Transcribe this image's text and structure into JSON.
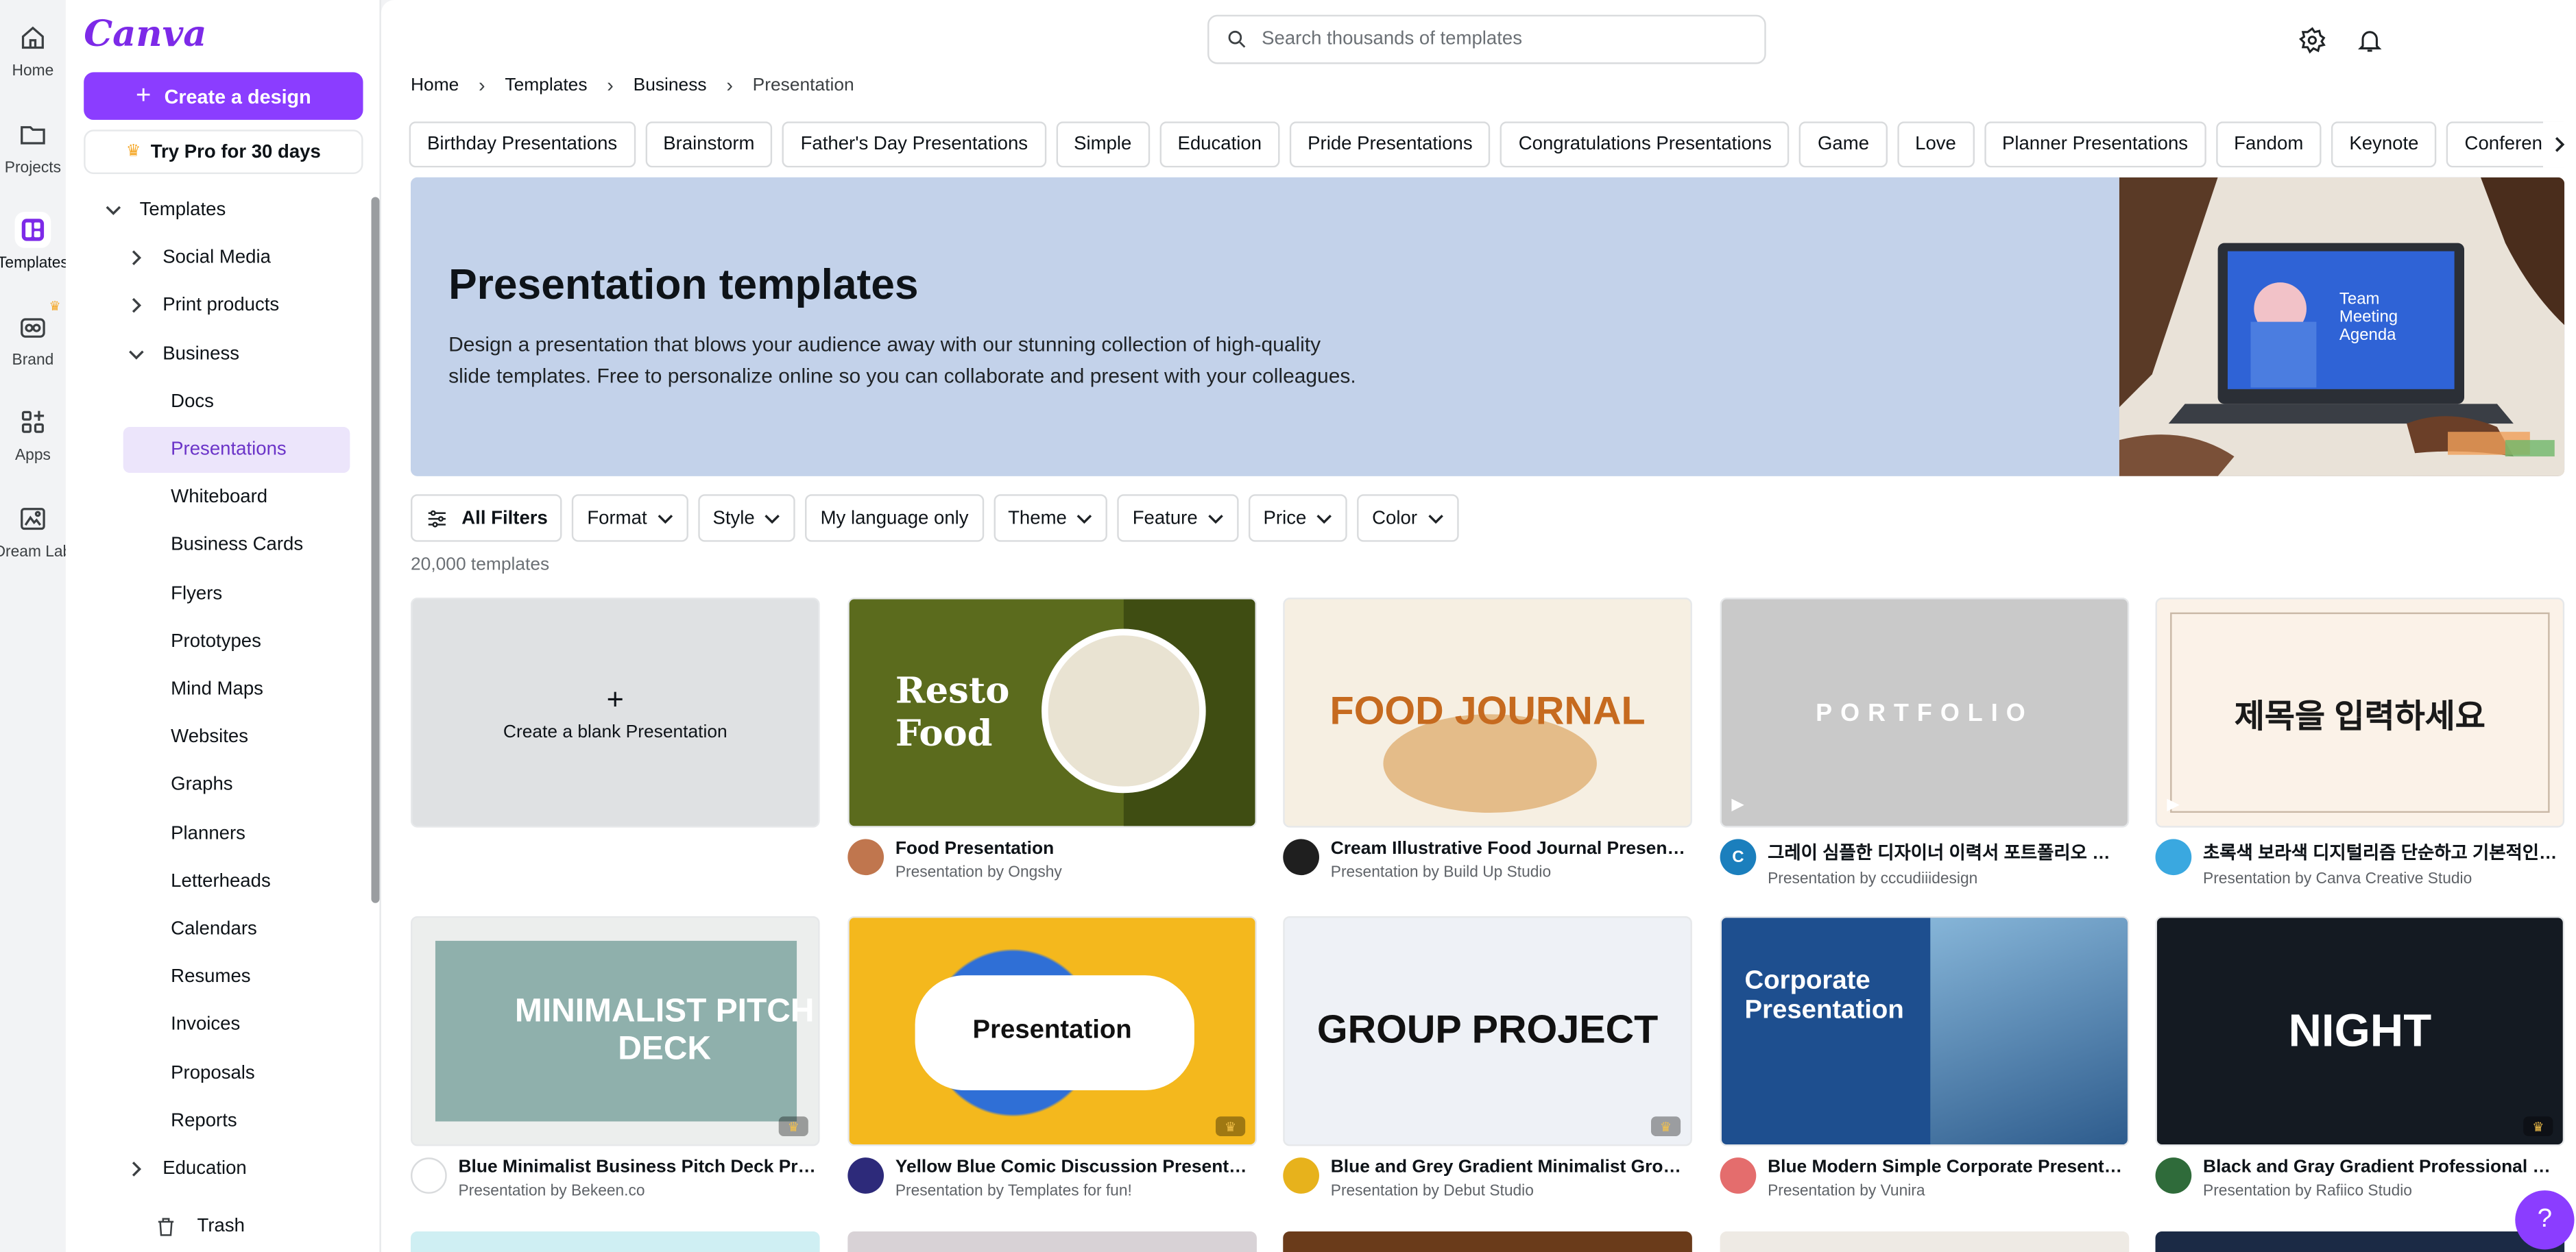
{
  "rail": [
    {
      "label": "Home",
      "icon": "home-icon"
    },
    {
      "label": "Projects",
      "icon": "folder-icon"
    },
    {
      "label": "Templates",
      "icon": "templates-icon"
    },
    {
      "label": "Brand",
      "icon": "brand-icon"
    },
    {
      "label": "Apps",
      "icon": "apps-icon"
    },
    {
      "label": "Dream Lab",
      "icon": "dream-lab-icon"
    }
  ],
  "panel": {
    "logo": "Canva",
    "create_label": "Create a design",
    "trypro_label": "Try Pro for 30 days",
    "tree": [
      {
        "label": "Templates",
        "level": 0,
        "chevron": "down"
      },
      {
        "label": "Social Media",
        "level": 1,
        "chevron": "right"
      },
      {
        "label": "Print products",
        "level": 1,
        "chevron": "right"
      },
      {
        "label": "Business",
        "level": 1,
        "chevron": "down"
      },
      {
        "label": "Docs",
        "level": 2
      },
      {
        "label": "Presentations",
        "level": 2,
        "active": true
      },
      {
        "label": "Whiteboard",
        "level": 2
      },
      {
        "label": "Business Cards",
        "level": 2
      },
      {
        "label": "Flyers",
        "level": 2
      },
      {
        "label": "Prototypes",
        "level": 2
      },
      {
        "label": "Mind Maps",
        "level": 2
      },
      {
        "label": "Websites",
        "level": 2
      },
      {
        "label": "Graphs",
        "level": 2
      },
      {
        "label": "Planners",
        "level": 2
      },
      {
        "label": "Letterheads",
        "level": 2
      },
      {
        "label": "Calendars",
        "level": 2
      },
      {
        "label": "Resumes",
        "level": 2
      },
      {
        "label": "Invoices",
        "level": 2
      },
      {
        "label": "Proposals",
        "level": 2
      },
      {
        "label": "Reports",
        "level": 2
      },
      {
        "label": "Education",
        "level": 1,
        "chevron": "right"
      }
    ],
    "trash_label": "Trash"
  },
  "search": {
    "placeholder": "Search thousands of templates"
  },
  "breadcrumb": [
    "Home",
    "Templates",
    "Business",
    "Presentation"
  ],
  "chips": [
    "Birthday Presentations",
    "Brainstorm",
    "Father's Day Presentations",
    "Simple",
    "Education",
    "Pride Presentations",
    "Congratulations Presentations",
    "Game",
    "Love",
    "Planner Presentations",
    "Fandom",
    "Keynote",
    "Conferenc"
  ],
  "hero": {
    "title": "Presentation templates",
    "desc_line1": "Design a presentation that blows your audience away with our stunning collection of high-quality",
    "desc_line2": "slide templates. Free to personalize online so you can collaborate and present with your colleagues.",
    "laptop_lines": [
      "Team",
      "Meeting",
      "Agenda"
    ]
  },
  "filters": {
    "all": "All Filters",
    "items": [
      "Format",
      "Style",
      "My language only",
      "Theme",
      "Feature",
      "Price",
      "Color"
    ]
  },
  "count_label": "20,000 templates",
  "blank_label": "Create a blank Presentation",
  "cards": [
    {
      "title": "Food Presentation",
      "by": "Presentation by Ongshy",
      "avatar_color": "#c0764e",
      "avatar_text": "",
      "thumb_bg": "#5b6b1d",
      "thumb_text": "Resto Food",
      "thumb_text_color": "#ffffff"
    },
    {
      "title": "Cream Illustrative Food Journal Presentation",
      "by": "Presentation by Build Up Studio",
      "avatar_color": "#1f1f1f",
      "avatar_text": "",
      "thumb_bg": "#f6efe2",
      "thumb_text": "FOOD JOURNAL",
      "thumb_text_color": "#c66a1f"
    },
    {
      "title": "그레이 심플한 디자이너 이력서 포트폴리오 프레젠테이션",
      "by": "Presentation by cccudiiidesign",
      "avatar_color": "#1b7fbd",
      "avatar_text": "C",
      "thumb_bg": "#c9c9c9",
      "thumb_text": "PORTFOLIO",
      "thumb_text_color": "#ffffff"
    },
    {
      "title": "초록색 보라색 디지털리즘 단순하고 기본적인 프레젠테이션",
      "by": "Presentation by Canva Creative Studio",
      "avatar_color": "#3aa8e0",
      "avatar_text": "",
      "thumb_bg": "#fbf2e8",
      "thumb_text": "제목을 입력하세요",
      "thumb_text_color": "#1a1a1a"
    },
    {
      "title": "Blue Minimalist Business Pitch Deck Presentation",
      "by": "Presentation by Bekeen.co",
      "avatar_color": "#ffffff",
      "avatar_text": "",
      "thumb_bg": "#eceeed",
      "thumb_text": "MINIMALIST PITCH DECK",
      "thumb_text_color": "#ffffff"
    },
    {
      "title": "Yellow Blue Comic Discussion Presentation",
      "by": "Presentation by Templates for fun!",
      "avatar_color": "#2d2a7a",
      "avatar_text": "",
      "thumb_bg": "#f4b81d",
      "thumb_text": "Presentation",
      "thumb_text_color": "#111111"
    },
    {
      "title": "Blue and Grey Gradient Minimalist Group Project Presentation",
      "by": "Presentation by Debut Studio",
      "avatar_color": "#e7b21c",
      "avatar_text": "",
      "thumb_bg": "#eef1f6",
      "thumb_text": "GROUP PROJECT",
      "thumb_text_color": "#111111"
    },
    {
      "title": "Blue Modern Simple Corporate Presentation",
      "by": "Presentation by Vunira",
      "avatar_color": "#e46d6d",
      "avatar_text": "",
      "thumb_bg": "#1e4f8f",
      "thumb_text": "Corporate Presentation",
      "thumb_text_color": "#ffffff"
    },
    {
      "title": "Black and Gray Gradient Professional Presentation",
      "by": "Presentation by Rafiico Studio",
      "avatar_color": "#2f6b3a",
      "avatar_text": "",
      "thumb_bg": "#141a22",
      "thumb_text": "NIGHT",
      "thumb_text_color": "#ffffff"
    }
  ],
  "help_label": "?"
}
